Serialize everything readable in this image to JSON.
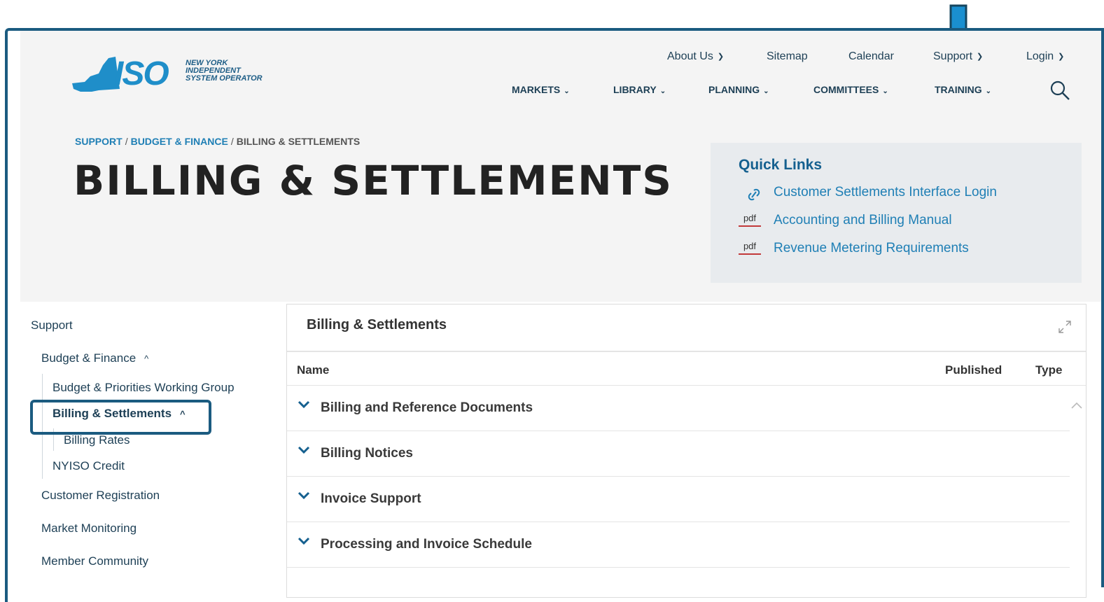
{
  "logo": {
    "iso": "ISO",
    "line1": "NEW YORK",
    "line2": "INDEPENDENT",
    "line3": "SYSTEM OPERATOR"
  },
  "utility_nav": [
    {
      "label": "About Us",
      "has_menu": true
    },
    {
      "label": "Sitemap",
      "has_menu": false
    },
    {
      "label": "Calendar",
      "has_menu": false
    },
    {
      "label": "Support",
      "has_menu": true
    },
    {
      "label": "Login",
      "has_menu": true
    }
  ],
  "main_nav": [
    {
      "label": "MARKETS"
    },
    {
      "label": "LIBRARY"
    },
    {
      "label": "PLANNING"
    },
    {
      "label": "COMMITTEES"
    },
    {
      "label": "TRAINING"
    }
  ],
  "breadcrumb": {
    "items": [
      "SUPPORT",
      "BUDGET & FINANCE",
      "BILLING & SETTLEMENTS"
    ],
    "separator": "/"
  },
  "page_title": "BILLING & SETTLEMENTS",
  "quick_links": {
    "heading": "Quick Links",
    "items": [
      {
        "icon": "link-icon",
        "label": "Customer Settlements Interface Login"
      },
      {
        "icon": "pdf-icon",
        "icon_text": "pdf",
        "label": "Accounting and Billing Manual"
      },
      {
        "icon": "pdf-icon",
        "icon_text": "pdf",
        "label": "Revenue Metering Requirements"
      }
    ]
  },
  "sidebar": {
    "root": "Support",
    "items": [
      {
        "label": "Budget & Finance",
        "expanded": true
      },
      {
        "label": "Budget & Priorities Working Group"
      },
      {
        "label": "Billing & Settlements",
        "expanded": true,
        "active": true
      },
      {
        "label": "Billing Rates"
      },
      {
        "label": "NYISO Credit"
      },
      {
        "label": "Customer Registration"
      },
      {
        "label": "Market Monitoring"
      },
      {
        "label": "Member Community"
      }
    ]
  },
  "panel": {
    "title": "Billing & Settlements",
    "columns": {
      "name": "Name",
      "published": "Published",
      "type": "Type"
    },
    "folders": [
      "Billing and Reference Documents",
      "Billing Notices",
      "Invoice Support",
      "Processing and Invoice Schedule"
    ]
  },
  "colors": {
    "accent": "#1b5b80",
    "link": "#1f7fb5",
    "arrow": "#1a8fd0",
    "hero_bg": "#f4f4f4"
  }
}
